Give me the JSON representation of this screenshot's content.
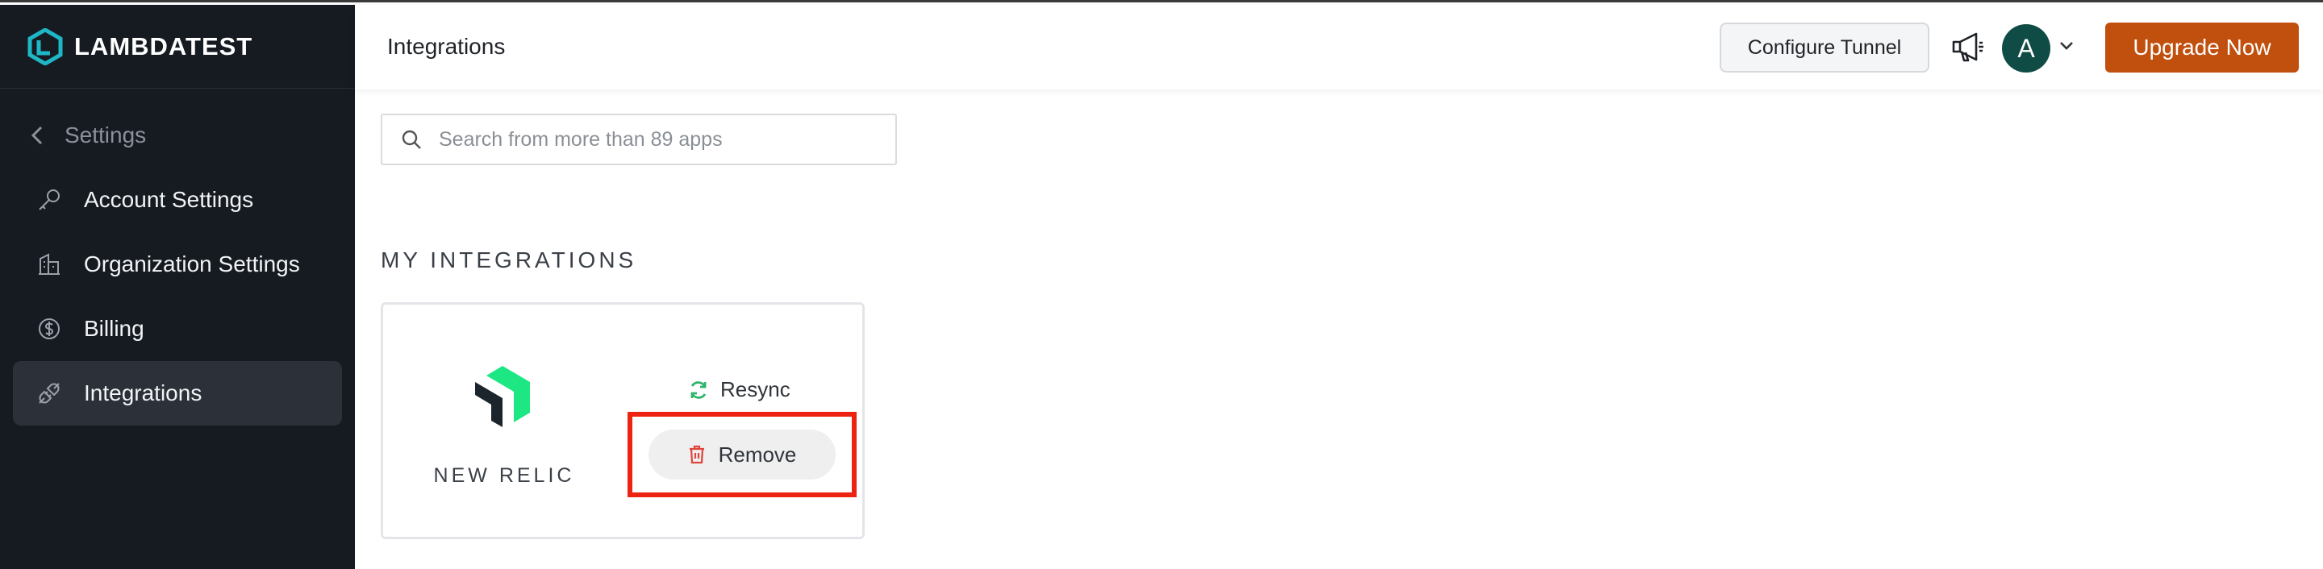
{
  "brand": {
    "name": "LAMBDATEST"
  },
  "sidebar": {
    "back_label": "Settings",
    "items": [
      {
        "label": "Account Settings",
        "icon": "key-icon"
      },
      {
        "label": "Organization Settings",
        "icon": "building-icon"
      },
      {
        "label": "Billing",
        "icon": "dollar-icon"
      },
      {
        "label": "Integrations",
        "icon": "plug-icon",
        "active": true
      }
    ]
  },
  "header": {
    "title": "Integrations",
    "tunnel_label": "Configure Tunnel",
    "avatar_initial": "A",
    "upgrade_label": "Upgrade Now"
  },
  "search": {
    "placeholder": "Search from more than 89 apps"
  },
  "my_integrations": {
    "title": "MY INTEGRATIONS",
    "cards": [
      {
        "name": "NEW RELIC",
        "resync_label": "Resync",
        "remove_label": "Remove"
      }
    ]
  },
  "colors": {
    "sidebar_bg": "#161b22",
    "accent_upgrade": "#c14f0d",
    "avatar_bg": "#0f4c45",
    "highlight": "#ee2211",
    "logo_teal": "#1fb6c5",
    "newrelic_green": "#1ce783"
  }
}
